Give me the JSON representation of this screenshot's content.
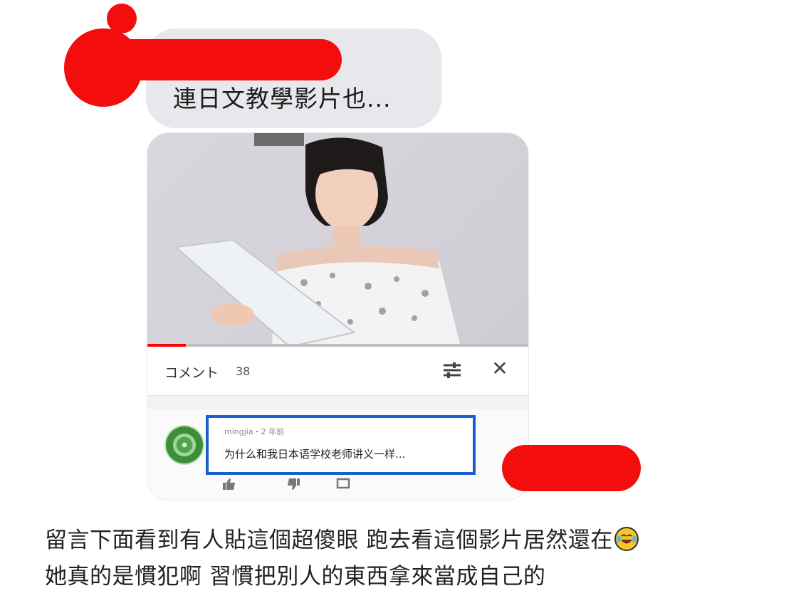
{
  "message": {
    "text": "連日文教學影片也..."
  },
  "video": {
    "progress_fraction": 0.1
  },
  "comments": {
    "title": "コメント",
    "count": "38",
    "filter_icon": "sliders-icon",
    "close_icon": "close-icon",
    "close_glyph": "✕",
    "items": [
      {
        "author_meta": "mingjia・2 年前",
        "text": "为什么和我日本语学校老师讲义一样..."
      }
    ],
    "actions": {
      "like_icon": "thumb-up-icon",
      "dislike_icon": "thumb-down-icon",
      "reply_icon": "reply-icon",
      "more_glyph": "⋮"
    }
  },
  "caption": {
    "line1": "留言下面看到有人貼這個超傻眼 跑去看這個影片居然還在",
    "line2": "她真的是慣犯啊 習慣把別人的東西拿來當成自己的",
    "emoji_icon": "laughing-tears-emoji-icon"
  },
  "colors": {
    "redaction": "#f30d0d",
    "highlight_border": "#1a5fd0",
    "bubble": "#e8e8ec"
  }
}
